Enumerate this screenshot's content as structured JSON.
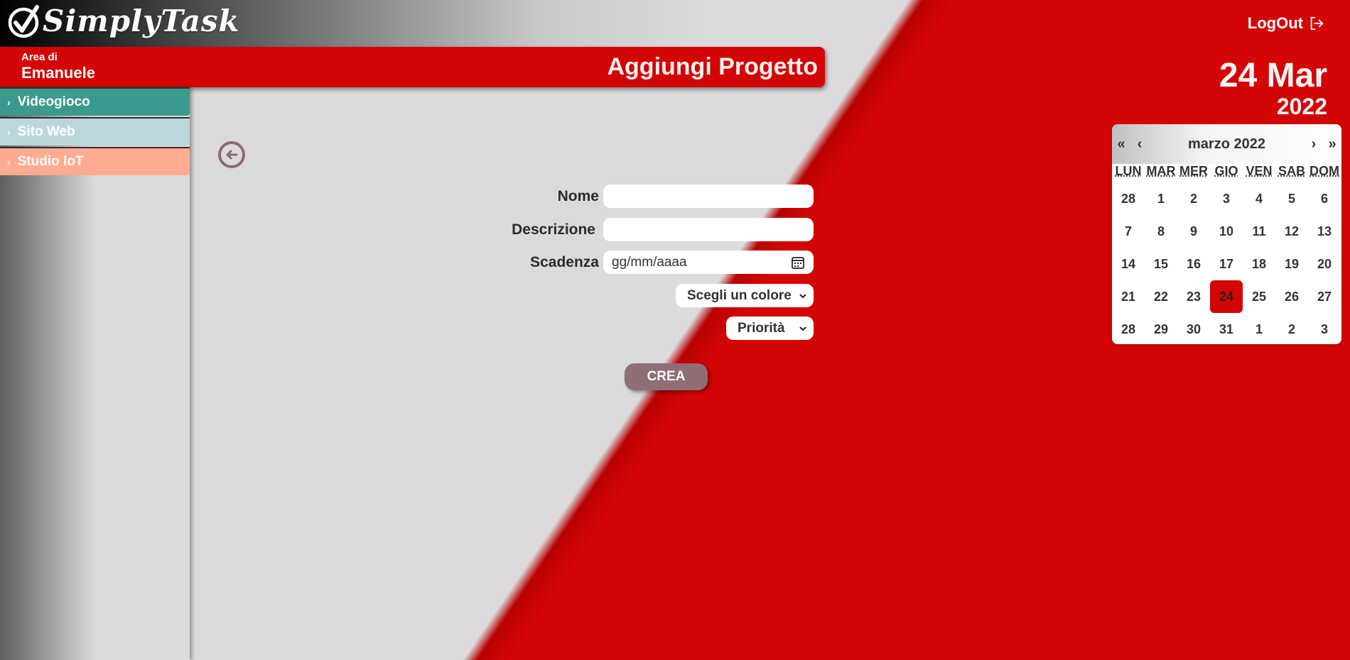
{
  "app": {
    "name": "SimplyTask",
    "logout_label": "LogOut"
  },
  "header": {
    "area_label": "Area di",
    "user_name": "Emanuele",
    "page_title": "Aggiungi Progetto"
  },
  "sidebar": {
    "items": [
      {
        "label": "Videogioco",
        "color": "#3a9a8e"
      },
      {
        "label": "Sito Web",
        "color": "#bcd7dc"
      },
      {
        "label": "Studio IoT",
        "color": "#ffab91"
      }
    ]
  },
  "date": {
    "day": "24 Mar",
    "year": "2022"
  },
  "calendar": {
    "month_label": "marzo 2022",
    "nav": {
      "prev_year": "«",
      "prev_month": "‹",
      "next_month": "›",
      "next_year": "»"
    },
    "weekdays": [
      "LUN",
      "MAR",
      "MER",
      "GIO",
      "VEN",
      "SAB",
      "DOM"
    ],
    "days": [
      "28",
      "1",
      "2",
      "3",
      "4",
      "5",
      "6",
      "7",
      "8",
      "9",
      "10",
      "11",
      "12",
      "13",
      "14",
      "15",
      "16",
      "17",
      "18",
      "19",
      "20",
      "21",
      "22",
      "23",
      "24",
      "25",
      "26",
      "27",
      "28",
      "29",
      "30",
      "31",
      "1",
      "2",
      "3"
    ],
    "today_index": 24,
    "accent_color": "#d40505"
  },
  "form": {
    "name_label": "Nome",
    "name_value": "",
    "description_label": "Descrizione",
    "description_value": "",
    "deadline_label": "Scadenza",
    "deadline_placeholder": "gg/mm/aaaa",
    "color_select": "Scegli un colore",
    "priority_select": "Priorità",
    "submit_label": "CREA"
  },
  "colors": {
    "primary": "#d40505",
    "button": "#8f6e76",
    "background": "#dcdadb"
  }
}
